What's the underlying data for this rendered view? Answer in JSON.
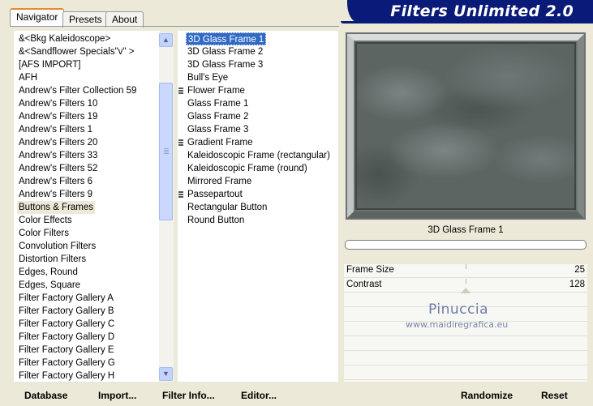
{
  "tabs": [
    "Navigator",
    "Presets",
    "About"
  ],
  "banner": "Filters Unlimited 2.0",
  "categories": [
    "&<Bkg Kaleidoscope>",
    "&<Sandflower Specials\"v\" >",
    "[AFS IMPORT]",
    "AFH",
    "Andrew's Filter Collection 59",
    "Andrew's Filters 10",
    "Andrew's Filters 19",
    "Andrew's Filters 1",
    "Andrew's Filters 20",
    "Andrew's Filters 33",
    "Andrew's Filters 52",
    "Andrew's Filters 6",
    "Andrew's Filters 9",
    "Buttons & Frames",
    "Color Effects",
    "Color Filters",
    "Convolution Filters",
    "Distortion Filters",
    "Edges, Round",
    "Edges, Square",
    "Filter Factory Gallery A",
    "Filter Factory Gallery B",
    "Filter Factory Gallery C",
    "Filter Factory Gallery D",
    "Filter Factory Gallery E",
    "Filter Factory Gallery G",
    "Filter Factory Gallery H"
  ],
  "selected_category_index": 13,
  "filters": [
    {
      "label": "3D Glass Frame 1",
      "grip": false
    },
    {
      "label": "3D Glass Frame 2",
      "grip": false
    },
    {
      "label": "3D Glass Frame 3",
      "grip": false
    },
    {
      "label": "Bull's Eye",
      "grip": false
    },
    {
      "label": "Flower Frame",
      "grip": true
    },
    {
      "label": "Glass Frame 1",
      "grip": false
    },
    {
      "label": "Glass Frame 2",
      "grip": false
    },
    {
      "label": "Glass Frame 3",
      "grip": false
    },
    {
      "label": "Gradient Frame",
      "grip": true
    },
    {
      "label": "Kaleidoscopic Frame (rectangular)",
      "grip": false
    },
    {
      "label": "Kaleidoscopic Frame (round)",
      "grip": false
    },
    {
      "label": "Mirrored Frame",
      "grip": false
    },
    {
      "label": "Passepartout",
      "grip": true
    },
    {
      "label": "Rectangular Button",
      "grip": false
    },
    {
      "label": "Round Button",
      "grip": false
    }
  ],
  "selected_filter_index": 0,
  "preview_name": "3D Glass Frame 1",
  "params": [
    {
      "name": "Frame Size",
      "value": "25"
    },
    {
      "name": "Contrast",
      "value": "128"
    }
  ],
  "watermark": {
    "line1": "Pinuccia",
    "line2": "www.maidiregrafica.eu"
  },
  "buttons": {
    "database": "Database",
    "import": "Import...",
    "filter_info": "Filter Info...",
    "editor": "Editor...",
    "randomize": "Randomize",
    "reset": "Reset"
  }
}
